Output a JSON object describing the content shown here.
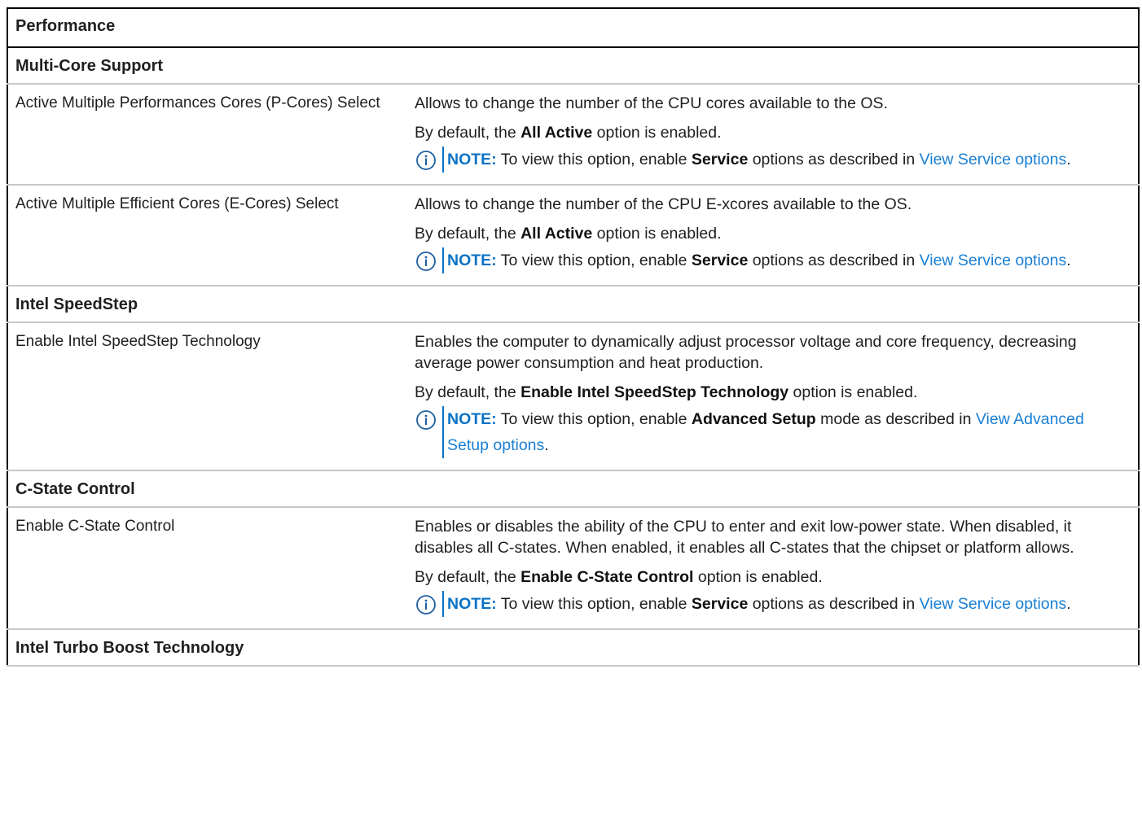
{
  "table": {
    "title": "Performance",
    "sections": [
      {
        "heading": "Multi-Core Support",
        "rows": [
          {
            "option": "Active Multiple Performances Cores (P-Cores) Select",
            "description": "Allows to change the number of the CPU cores available to the OS.",
            "default_prefix": "By default, the ",
            "default_bold": "All Active",
            "default_suffix": " option is enabled.",
            "note_label": "NOTE:",
            "note_prefix": " To view this option, enable ",
            "note_bold": "Service",
            "note_middle": " options as described in ",
            "note_link": "View Service options",
            "note_suffix": "."
          },
          {
            "option": "Active Multiple Efficient Cores (E-Cores) Select",
            "description": "Allows to change the number of the CPU E-xcores available to the OS.",
            "default_prefix": "By default, the ",
            "default_bold": "All Active",
            "default_suffix": " option is enabled.",
            "note_label": "NOTE:",
            "note_prefix": " To view this option, enable ",
            "note_bold": "Service",
            "note_middle": " options as described in ",
            "note_link": "View Service options",
            "note_suffix": "."
          }
        ]
      },
      {
        "heading": "Intel SpeedStep",
        "rows": [
          {
            "option": "Enable Intel SpeedStep Technology",
            "description": "Enables the computer to dynamically adjust processor voltage and core frequency, decreasing average power consumption and heat production.",
            "default_prefix": "By default, the ",
            "default_bold": "Enable Intel SpeedStep Technology",
            "default_suffix": " option is enabled.",
            "note_label": "NOTE:",
            "note_prefix": " To view this option, enable ",
            "note_bold": "Advanced Setup",
            "note_middle": " mode as described in ",
            "note_link": "View Advanced Setup options",
            "note_suffix": "."
          }
        ]
      },
      {
        "heading": "C-State Control",
        "rows": [
          {
            "option": "Enable C-State Control",
            "description": "Enables or disables the ability of the CPU to enter and exit low-power state. When disabled, it disables all C-states. When enabled, it enables all C-states that the chipset or platform allows.",
            "default_prefix": "By default, the ",
            "default_bold": "Enable C-State Control",
            "default_suffix": " option is enabled.",
            "note_label": "NOTE:",
            "note_prefix": " To view this option, enable ",
            "note_bold": "Service",
            "note_middle": " options as described in ",
            "note_link": "View Service options",
            "note_suffix": "."
          }
        ]
      },
      {
        "heading": "Intel Turbo Boost Technology",
        "rows": []
      }
    ]
  },
  "colors": {
    "note_accent": "#0a72c6",
    "link": "#1a7fd4"
  }
}
